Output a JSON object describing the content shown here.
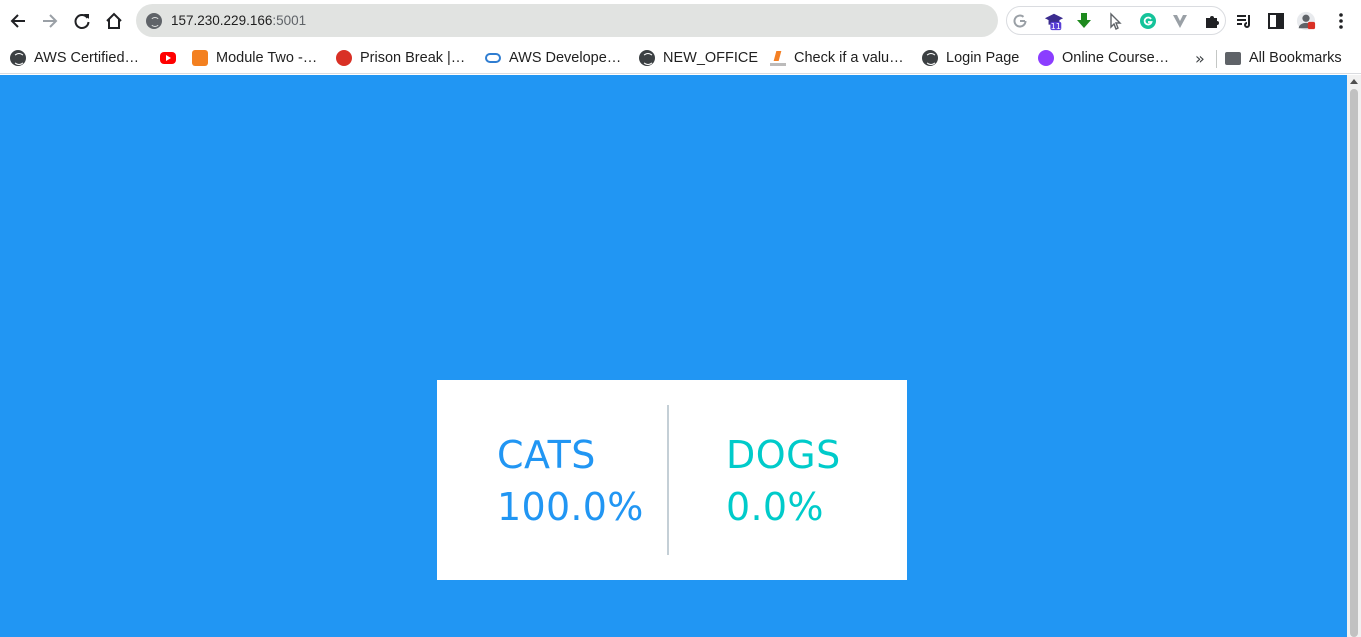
{
  "browser": {
    "url_host": "157.230.229.166",
    "url_port": ":5001",
    "extensions": [
      "google-icon",
      "graduation-cap-icon",
      "download-arrow-icon",
      "cursor-icon",
      "grammarly-icon",
      "vimium-icon",
      "puzzle-extensions-icon"
    ],
    "extension_badge": "11"
  },
  "bookmarks": {
    "items": [
      {
        "label": "AWS Certified…",
        "icon": "globe-icon"
      },
      {
        "label": "",
        "icon": "youtube-icon"
      },
      {
        "label": "Module Two -…",
        "icon": "cube-icon"
      },
      {
        "label": "Prison Break |…",
        "icon": "prison-break-icon"
      },
      {
        "label": "AWS Develope…",
        "icon": "aws-icon"
      },
      {
        "label": "NEW_OFFICE",
        "icon": "globe-icon"
      },
      {
        "label": "Check if a valu…",
        "icon": "stackoverflow-icon"
      },
      {
        "label": "Login Page",
        "icon": "globe-icon"
      },
      {
        "label": "Online Course…",
        "icon": "course-icon"
      }
    ],
    "more": "»",
    "all_bookmarks": "All Bookmarks"
  },
  "results": {
    "option_a": {
      "label": "CATS",
      "percent": "100.0%",
      "color": "#2196f3"
    },
    "option_b": {
      "label": "DOGS",
      "percent": "0.0%",
      "color": "#00cbca"
    },
    "background": "#2196f3"
  }
}
